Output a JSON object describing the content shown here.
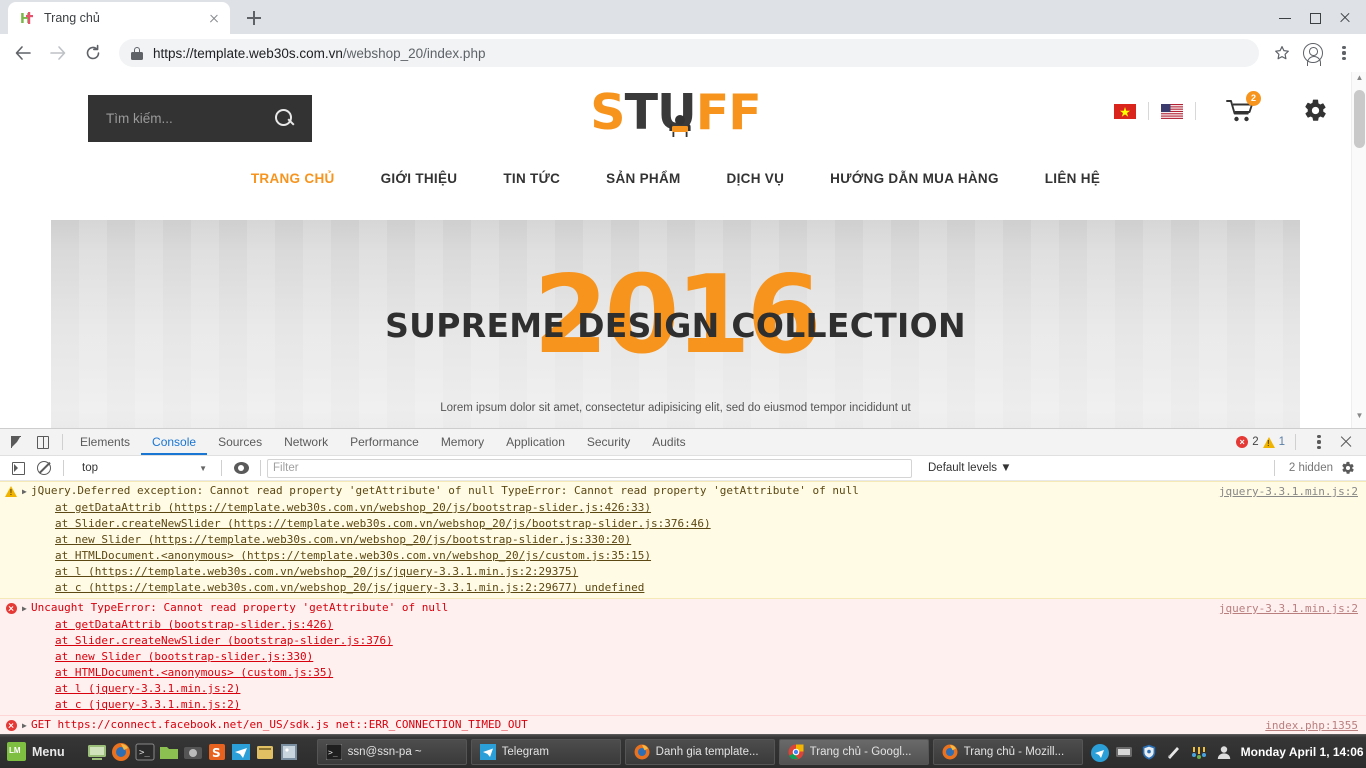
{
  "browser": {
    "tab": {
      "title": "Trang chủ",
      "favicon": "ht-favicon"
    },
    "new_tab_label": "+",
    "url_secure": "https://template.web30s.com.vn",
    "url_path": "/webshop_20/index.php",
    "nav": {
      "back": "←",
      "forward": "→",
      "reload": "⟳"
    },
    "window_controls": {
      "minimize": "–",
      "maximize": "□",
      "close": "×"
    }
  },
  "site": {
    "search": {
      "placeholder": "Tìm kiếm...",
      "icon": "search-icon"
    },
    "logo": {
      "part1": "S",
      "part2": "TU",
      "part3": "FF",
      "orange": "#f7941e",
      "dark": "#3a3a3a"
    },
    "header_icons": {
      "flag_vi": "vietnam-flag",
      "flag_en": "usa-flag",
      "cart_count": "2",
      "settings": "gear-icon"
    },
    "nav": [
      {
        "label": "TRANG CHỦ",
        "active": true
      },
      {
        "label": "GIỚI THIỆU",
        "active": false
      },
      {
        "label": "TIN TỨC",
        "active": false
      },
      {
        "label": "SẢN PHẨM",
        "active": false
      },
      {
        "label": "DỊCH VỤ",
        "active": false
      },
      {
        "label": "HƯỚNG DẪN MUA HÀNG",
        "active": false
      },
      {
        "label": "LIÊN HỆ",
        "active": false
      }
    ],
    "hero": {
      "year": "2016",
      "title": "SUPREME DESIGN COLLECTION",
      "subtitle": "Lorem ipsum dolor sit amet, consectetur adipisicing elit, sed do eiusmod tempor incididunt ut",
      "prev": "‹",
      "next": "›"
    }
  },
  "devtools": {
    "tabs": [
      {
        "label": "Elements",
        "active": false
      },
      {
        "label": "Console",
        "active": true
      },
      {
        "label": "Sources",
        "active": false
      },
      {
        "label": "Network",
        "active": false
      },
      {
        "label": "Performance",
        "active": false
      },
      {
        "label": "Memory",
        "active": false
      },
      {
        "label": "Application",
        "active": false
      },
      {
        "label": "Security",
        "active": false
      },
      {
        "label": "Audits",
        "active": false
      }
    ],
    "counts": {
      "errors": "2",
      "warnings": "1"
    },
    "toolbar": {
      "context": "top",
      "context_caret": "▼",
      "filter_placeholder": "Filter",
      "levels": "Default levels ▼",
      "hidden": "2 hidden"
    },
    "messages": [
      {
        "level": "warn",
        "source": "jquery-3.3.1.min.js:2",
        "lines": [
          "jQuery.Deferred exception: Cannot read property 'getAttribute' of null TypeError: Cannot read property 'getAttribute' of null",
          "    at getDataAttrib (https://template.web30s.com.vn/webshop_20/js/bootstrap-slider.js:426:33)",
          "    at Slider.createNewSlider (https://template.web30s.com.vn/webshop_20/js/bootstrap-slider.js:376:46)",
          "    at new Slider (https://template.web30s.com.vn/webshop_20/js/bootstrap-slider.js:330:20)",
          "    at HTMLDocument.<anonymous> (https://template.web30s.com.vn/webshop_20/js/custom.js:35:15)",
          "    at l (https://template.web30s.com.vn/webshop_20/js/jquery-3.3.1.min.js:2:29375)",
          "    at c (https://template.web30s.com.vn/webshop_20/js/jquery-3.3.1.min.js:2:29677) undefined"
        ]
      },
      {
        "level": "error",
        "source": "jquery-3.3.1.min.js:2",
        "lines": [
          "Uncaught TypeError: Cannot read property 'getAttribute' of null",
          "    at getDataAttrib (bootstrap-slider.js:426)",
          "    at Slider.createNewSlider (bootstrap-slider.js:376)",
          "    at new Slider (bootstrap-slider.js:330)",
          "    at HTMLDocument.<anonymous> (custom.js:35)",
          "    at l (jquery-3.3.1.min.js:2)",
          "    at c (jquery-3.3.1.min.js:2)"
        ]
      },
      {
        "level": "error",
        "source": "index.php:1355",
        "lines": [
          "GET https://connect.facebook.net/en_US/sdk.js net::ERR_CONNECTION_TIMED_OUT"
        ]
      }
    ],
    "prompt": ">"
  },
  "taskbar": {
    "menu_label": "Menu",
    "windows": [
      {
        "title": "ssn@ssn-pa ~",
        "icon": "terminal-icon",
        "active": false
      },
      {
        "title": "Telegram",
        "icon": "telegram-icon",
        "active": false
      },
      {
        "title": "Danh gia template...",
        "icon": "firefox-icon",
        "active": false
      },
      {
        "title": "Trang chủ - Googl...",
        "icon": "chrome-icon",
        "active": true
      },
      {
        "title": "Trang chủ - Mozill...",
        "icon": "firefox-icon",
        "active": false
      }
    ],
    "clock": "Monday April  1, 14:06"
  }
}
